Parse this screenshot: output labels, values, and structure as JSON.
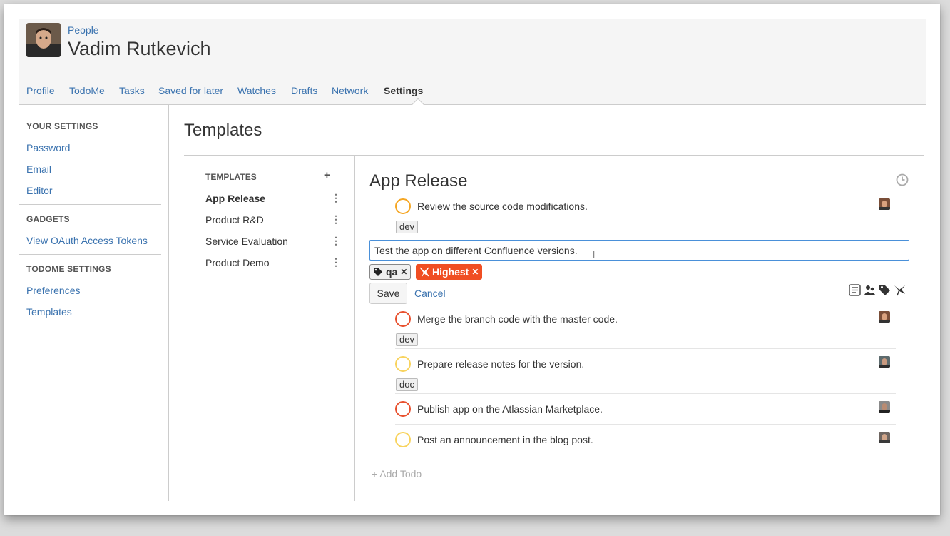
{
  "header": {
    "breadcrumb": "People",
    "title": "Vadim Rutkevich"
  },
  "tabs": [
    {
      "label": "Profile"
    },
    {
      "label": "TodoMe"
    },
    {
      "label": "Tasks"
    },
    {
      "label": "Saved for later"
    },
    {
      "label": "Watches"
    },
    {
      "label": "Drafts"
    },
    {
      "label": "Network"
    },
    {
      "label": "Settings",
      "active": true
    }
  ],
  "sidebar": {
    "your_settings": {
      "heading": "YOUR SETTINGS",
      "items": [
        "Password",
        "Email",
        "Editor"
      ]
    },
    "gadgets": {
      "heading": "GADGETS",
      "items": [
        "View OAuth Access Tokens"
      ]
    },
    "todome_settings": {
      "heading": "TODOME SETTINGS",
      "items": [
        "Preferences",
        "Templates"
      ]
    }
  },
  "content": {
    "title": "Templates",
    "templates_heading": "TEMPLATES",
    "add_symbol": "+",
    "more_symbol": "⋮",
    "templates": [
      {
        "name": "App Release",
        "active": true
      },
      {
        "name": "Product R&D"
      },
      {
        "name": "Service Evaluation"
      },
      {
        "name": "Product Demo"
      }
    ]
  },
  "detail": {
    "title": "App Release",
    "todos_before": [
      {
        "text": "Review the source code modifications.",
        "priority_color": "#f5a623",
        "tag": "dev"
      }
    ],
    "editing": {
      "value": "Test the app on different Confluence versions.",
      "tag_chip": "qa",
      "priority_chip": "Highest",
      "save_label": "Save",
      "cancel_label": "Cancel",
      "remove_symbol": "✕"
    },
    "todos_after": [
      {
        "text": "Merge the branch code with the master code.",
        "priority_color": "#e8502e",
        "tag": "dev"
      },
      {
        "text": "Prepare release notes for the version.",
        "priority_color": "#f8d35e",
        "tag": "doc"
      },
      {
        "text": "Publish app on the Atlassian Marketplace.",
        "priority_color": "#e8502e",
        "tag": ""
      },
      {
        "text": "Post an announcement in the blog post.",
        "priority_color": "#f8d35e",
        "tag": ""
      }
    ],
    "add_todo_label": "+ Add Todo"
  },
  "colors": {
    "link": "#3b73af",
    "priority_highest": "#f04e23",
    "input_border": "#4a90d9"
  }
}
